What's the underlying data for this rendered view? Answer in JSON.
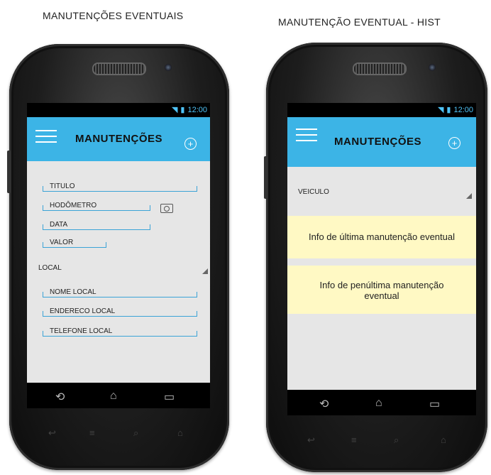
{
  "captions": {
    "left": "MANUTENÇÕES EVENTUAIS",
    "right": "MANUTENÇÃO EVENTUAL - HIST"
  },
  "status": {
    "time": "12:00"
  },
  "left_screen": {
    "title": "MANUTENÇÕES",
    "fields": {
      "titulo": "TITULO",
      "hodometro": "HODÔMETRO",
      "data": "DATA",
      "valor": "VALOR",
      "local": "LOCAL",
      "nome_local": "NOME LOCAL",
      "endereco_local": "ENDERECO LOCAL",
      "telefone_local": "TELEFONE LOCAL"
    }
  },
  "right_screen": {
    "title": "MANUTENÇÕES",
    "veiculo": "VEICULO",
    "card1": "Info de última manutenção eventual",
    "card2": "Info de penúltima manutenção eventual"
  },
  "colors": {
    "appbar": "#3cb4e6",
    "card": "#fff9c4",
    "underline": "#3ba3d6"
  },
  "icons": [
    "menu-icon",
    "add-icon",
    "camera-icon",
    "wifi-icon",
    "signal-icon",
    "battery-icon",
    "back-icon",
    "home-icon",
    "recents-icon"
  ]
}
